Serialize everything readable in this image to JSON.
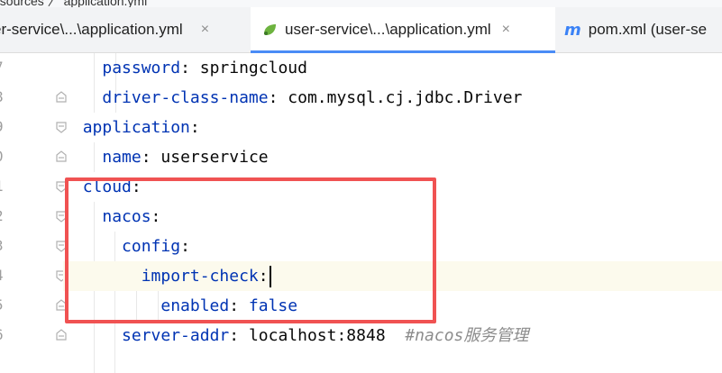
{
  "breadcrumb": {
    "text": "esources 〉 application.yml"
  },
  "tabs": [
    {
      "label": "er-service\\...\\application.yml",
      "close": "×",
      "active": false,
      "icon": ""
    },
    {
      "label": "user-service\\...\\application.yml",
      "close": "×",
      "active": true,
      "icon": "spring-leaf-icon"
    },
    {
      "label": "pom.xml (user-se",
      "close": "",
      "active": false,
      "icon": "maven-m-icon",
      "icon_glyph": "m"
    }
  ],
  "line_numbers": [
    "7",
    "8",
    "9",
    "0",
    "1",
    "2",
    "3",
    "4",
    "5",
    "6"
  ],
  "code": {
    "l1": {
      "key": "password",
      "sep": ": ",
      "value": "springcloud"
    },
    "l2": {
      "key": "driver-class-name",
      "sep": ": ",
      "value": "com.mysql.cj.jdbc.Driver"
    },
    "l3": {
      "key": "application",
      "sep": ":"
    },
    "l4": {
      "key": "name",
      "sep": ": ",
      "value": "userservice"
    },
    "l5": {
      "key": "cloud",
      "sep": ":"
    },
    "l6": {
      "key": "nacos",
      "sep": ":"
    },
    "l7": {
      "key": "config",
      "sep": ":"
    },
    "l8": {
      "key": "import-check",
      "sep": ":"
    },
    "l9": {
      "key": "enabled",
      "sep": ": ",
      "value": "false"
    },
    "l10": {
      "key": "server-addr",
      "sep": ": ",
      "value": "localhost:8848",
      "comment": "#nacos服务管理"
    }
  },
  "colors": {
    "key": "#0033b3",
    "highlight_box": "#f05252",
    "active_tab_underline": "#4a8cf6",
    "current_line": "#fcfaed"
  }
}
